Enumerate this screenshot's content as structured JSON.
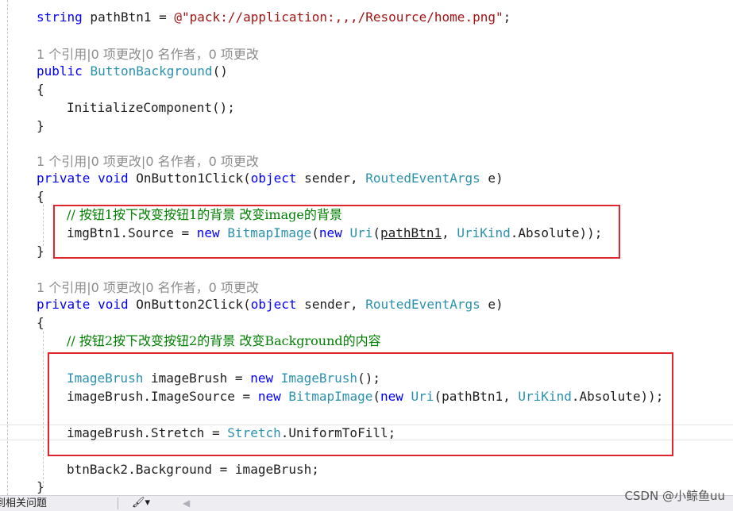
{
  "code": {
    "line_path": {
      "kw": "string",
      "var": " pathBtn1 = ",
      "str": "@\"pack://application:,,,/Resource/home.png\"",
      "end": ";"
    },
    "lens": "1 个引用|0 项更改|0 名作者，0 项更改",
    "ctor": {
      "kw": "public",
      "name": "ButtonBackground",
      "rest": "()"
    },
    "brace_open": "{",
    "brace_close": "}",
    "init_call": "InitializeComponent();",
    "m1": {
      "kw1": "private",
      "kw2": "void",
      "name": "OnButton1Click(",
      "p_type": "object",
      "p1": " sender, ",
      "args_type": "RoutedEventArgs",
      "p2": " e)"
    },
    "m1_comment": "// 按钮1按下改变按钮1的背景 改变image的背景",
    "m1_stmt": {
      "a": "imgBtn1.Source = ",
      "new1": "new",
      "t1": "BitmapImage",
      "b": "(",
      "new2": "new",
      "t2": "Uri",
      "c": "(",
      "arg": "pathBtn1",
      "d": ", ",
      "enum": "UriKind",
      "e": ".Absolute));"
    },
    "m2": {
      "kw1": "private",
      "kw2": "void",
      "name": "OnButton2Click(",
      "p_type": "object",
      "p1": " sender, ",
      "args_type": "RoutedEventArgs",
      "p2": " e)"
    },
    "m2_comment": "// 按钮2按下改变按钮2的背景 改变Background的内容",
    "s1": {
      "t1": "ImageBrush",
      "a": " imageBrush = ",
      "new1": "new",
      "sp": " ",
      "t2": "ImageBrush",
      "b": "();"
    },
    "s2": {
      "a": "imageBrush.ImageSource = ",
      "new1": "new",
      "sp": " ",
      "t1": "BitmapImage",
      "b": "(",
      "new2": "new",
      "sp2": " ",
      "t2": "Uri",
      "c": "(pathBtn1, ",
      "enum": "UriKind",
      "d": ".Absolute));"
    },
    "s3": {
      "a": "imageBrush.Stretch = ",
      "t1": "Stretch",
      "b": ".UniformToFill;"
    },
    "s4": "btnBack2.Background = imageBrush;"
  },
  "statusbar": {
    "left_text": "到相关问题",
    "brush_icon": "brush-icon",
    "arrow_icon": "arrow-left-icon"
  },
  "watermark": "CSDN @小鲸鱼uu",
  "colors": {
    "keyword": "#0000ff",
    "type": "#2b91af",
    "string": "#a31515",
    "comment": "#008000",
    "lens": "#8c8c8c",
    "highlight_box": "#e0242b"
  }
}
